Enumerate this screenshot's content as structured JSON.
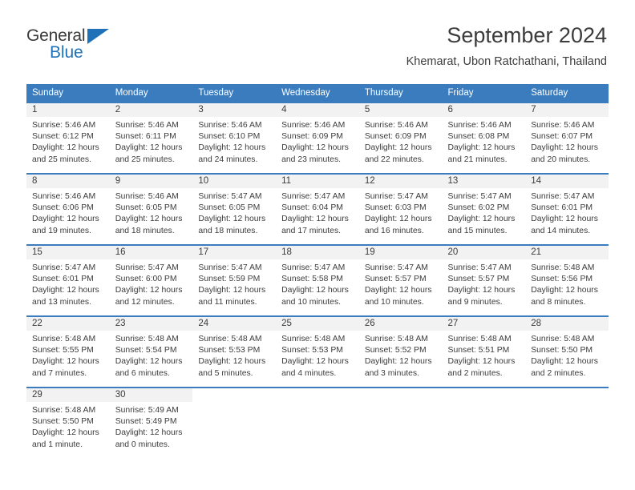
{
  "brand": {
    "name_part1": "General",
    "name_part2": "Blue",
    "accent_color": "#1f72b8"
  },
  "header": {
    "title": "September 2024",
    "location": "Khemarat, Ubon Ratchathani, Thailand"
  },
  "calendar": {
    "header_color": "#3a7cbe",
    "weekdays": [
      "Sunday",
      "Monday",
      "Tuesday",
      "Wednesday",
      "Thursday",
      "Friday",
      "Saturday"
    ],
    "weeks": [
      [
        {
          "day": "1",
          "sunrise": "Sunrise: 5:46 AM",
          "sunset": "Sunset: 6:12 PM",
          "daylight1": "Daylight: 12 hours",
          "daylight2": "and 25 minutes."
        },
        {
          "day": "2",
          "sunrise": "Sunrise: 5:46 AM",
          "sunset": "Sunset: 6:11 PM",
          "daylight1": "Daylight: 12 hours",
          "daylight2": "and 25 minutes."
        },
        {
          "day": "3",
          "sunrise": "Sunrise: 5:46 AM",
          "sunset": "Sunset: 6:10 PM",
          "daylight1": "Daylight: 12 hours",
          "daylight2": "and 24 minutes."
        },
        {
          "day": "4",
          "sunrise": "Sunrise: 5:46 AM",
          "sunset": "Sunset: 6:09 PM",
          "daylight1": "Daylight: 12 hours",
          "daylight2": "and 23 minutes."
        },
        {
          "day": "5",
          "sunrise": "Sunrise: 5:46 AM",
          "sunset": "Sunset: 6:09 PM",
          "daylight1": "Daylight: 12 hours",
          "daylight2": "and 22 minutes."
        },
        {
          "day": "6",
          "sunrise": "Sunrise: 5:46 AM",
          "sunset": "Sunset: 6:08 PM",
          "daylight1": "Daylight: 12 hours",
          "daylight2": "and 21 minutes."
        },
        {
          "day": "7",
          "sunrise": "Sunrise: 5:46 AM",
          "sunset": "Sunset: 6:07 PM",
          "daylight1": "Daylight: 12 hours",
          "daylight2": "and 20 minutes."
        }
      ],
      [
        {
          "day": "8",
          "sunrise": "Sunrise: 5:46 AM",
          "sunset": "Sunset: 6:06 PM",
          "daylight1": "Daylight: 12 hours",
          "daylight2": "and 19 minutes."
        },
        {
          "day": "9",
          "sunrise": "Sunrise: 5:46 AM",
          "sunset": "Sunset: 6:05 PM",
          "daylight1": "Daylight: 12 hours",
          "daylight2": "and 18 minutes."
        },
        {
          "day": "10",
          "sunrise": "Sunrise: 5:47 AM",
          "sunset": "Sunset: 6:05 PM",
          "daylight1": "Daylight: 12 hours",
          "daylight2": "and 18 minutes."
        },
        {
          "day": "11",
          "sunrise": "Sunrise: 5:47 AM",
          "sunset": "Sunset: 6:04 PM",
          "daylight1": "Daylight: 12 hours",
          "daylight2": "and 17 minutes."
        },
        {
          "day": "12",
          "sunrise": "Sunrise: 5:47 AM",
          "sunset": "Sunset: 6:03 PM",
          "daylight1": "Daylight: 12 hours",
          "daylight2": "and 16 minutes."
        },
        {
          "day": "13",
          "sunrise": "Sunrise: 5:47 AM",
          "sunset": "Sunset: 6:02 PM",
          "daylight1": "Daylight: 12 hours",
          "daylight2": "and 15 minutes."
        },
        {
          "day": "14",
          "sunrise": "Sunrise: 5:47 AM",
          "sunset": "Sunset: 6:01 PM",
          "daylight1": "Daylight: 12 hours",
          "daylight2": "and 14 minutes."
        }
      ],
      [
        {
          "day": "15",
          "sunrise": "Sunrise: 5:47 AM",
          "sunset": "Sunset: 6:01 PM",
          "daylight1": "Daylight: 12 hours",
          "daylight2": "and 13 minutes."
        },
        {
          "day": "16",
          "sunrise": "Sunrise: 5:47 AM",
          "sunset": "Sunset: 6:00 PM",
          "daylight1": "Daylight: 12 hours",
          "daylight2": "and 12 minutes."
        },
        {
          "day": "17",
          "sunrise": "Sunrise: 5:47 AM",
          "sunset": "Sunset: 5:59 PM",
          "daylight1": "Daylight: 12 hours",
          "daylight2": "and 11 minutes."
        },
        {
          "day": "18",
          "sunrise": "Sunrise: 5:47 AM",
          "sunset": "Sunset: 5:58 PM",
          "daylight1": "Daylight: 12 hours",
          "daylight2": "and 10 minutes."
        },
        {
          "day": "19",
          "sunrise": "Sunrise: 5:47 AM",
          "sunset": "Sunset: 5:57 PM",
          "daylight1": "Daylight: 12 hours",
          "daylight2": "and 10 minutes."
        },
        {
          "day": "20",
          "sunrise": "Sunrise: 5:47 AM",
          "sunset": "Sunset: 5:57 PM",
          "daylight1": "Daylight: 12 hours",
          "daylight2": "and 9 minutes."
        },
        {
          "day": "21",
          "sunrise": "Sunrise: 5:48 AM",
          "sunset": "Sunset: 5:56 PM",
          "daylight1": "Daylight: 12 hours",
          "daylight2": "and 8 minutes."
        }
      ],
      [
        {
          "day": "22",
          "sunrise": "Sunrise: 5:48 AM",
          "sunset": "Sunset: 5:55 PM",
          "daylight1": "Daylight: 12 hours",
          "daylight2": "and 7 minutes."
        },
        {
          "day": "23",
          "sunrise": "Sunrise: 5:48 AM",
          "sunset": "Sunset: 5:54 PM",
          "daylight1": "Daylight: 12 hours",
          "daylight2": "and 6 minutes."
        },
        {
          "day": "24",
          "sunrise": "Sunrise: 5:48 AM",
          "sunset": "Sunset: 5:53 PM",
          "daylight1": "Daylight: 12 hours",
          "daylight2": "and 5 minutes."
        },
        {
          "day": "25",
          "sunrise": "Sunrise: 5:48 AM",
          "sunset": "Sunset: 5:53 PM",
          "daylight1": "Daylight: 12 hours",
          "daylight2": "and 4 minutes."
        },
        {
          "day": "26",
          "sunrise": "Sunrise: 5:48 AM",
          "sunset": "Sunset: 5:52 PM",
          "daylight1": "Daylight: 12 hours",
          "daylight2": "and 3 minutes."
        },
        {
          "day": "27",
          "sunrise": "Sunrise: 5:48 AM",
          "sunset": "Sunset: 5:51 PM",
          "daylight1": "Daylight: 12 hours",
          "daylight2": "and 2 minutes."
        },
        {
          "day": "28",
          "sunrise": "Sunrise: 5:48 AM",
          "sunset": "Sunset: 5:50 PM",
          "daylight1": "Daylight: 12 hours",
          "daylight2": "and 2 minutes."
        }
      ],
      [
        {
          "day": "29",
          "sunrise": "Sunrise: 5:48 AM",
          "sunset": "Sunset: 5:50 PM",
          "daylight1": "Daylight: 12 hours",
          "daylight2": "and 1 minute."
        },
        {
          "day": "30",
          "sunrise": "Sunrise: 5:49 AM",
          "sunset": "Sunset: 5:49 PM",
          "daylight1": "Daylight: 12 hours",
          "daylight2": "and 0 minutes."
        },
        {
          "day": "",
          "sunrise": "",
          "sunset": "",
          "daylight1": "",
          "daylight2": ""
        },
        {
          "day": "",
          "sunrise": "",
          "sunset": "",
          "daylight1": "",
          "daylight2": ""
        },
        {
          "day": "",
          "sunrise": "",
          "sunset": "",
          "daylight1": "",
          "daylight2": ""
        },
        {
          "day": "",
          "sunrise": "",
          "sunset": "",
          "daylight1": "",
          "daylight2": ""
        },
        {
          "day": "",
          "sunrise": "",
          "sunset": "",
          "daylight1": "",
          "daylight2": ""
        }
      ]
    ]
  }
}
